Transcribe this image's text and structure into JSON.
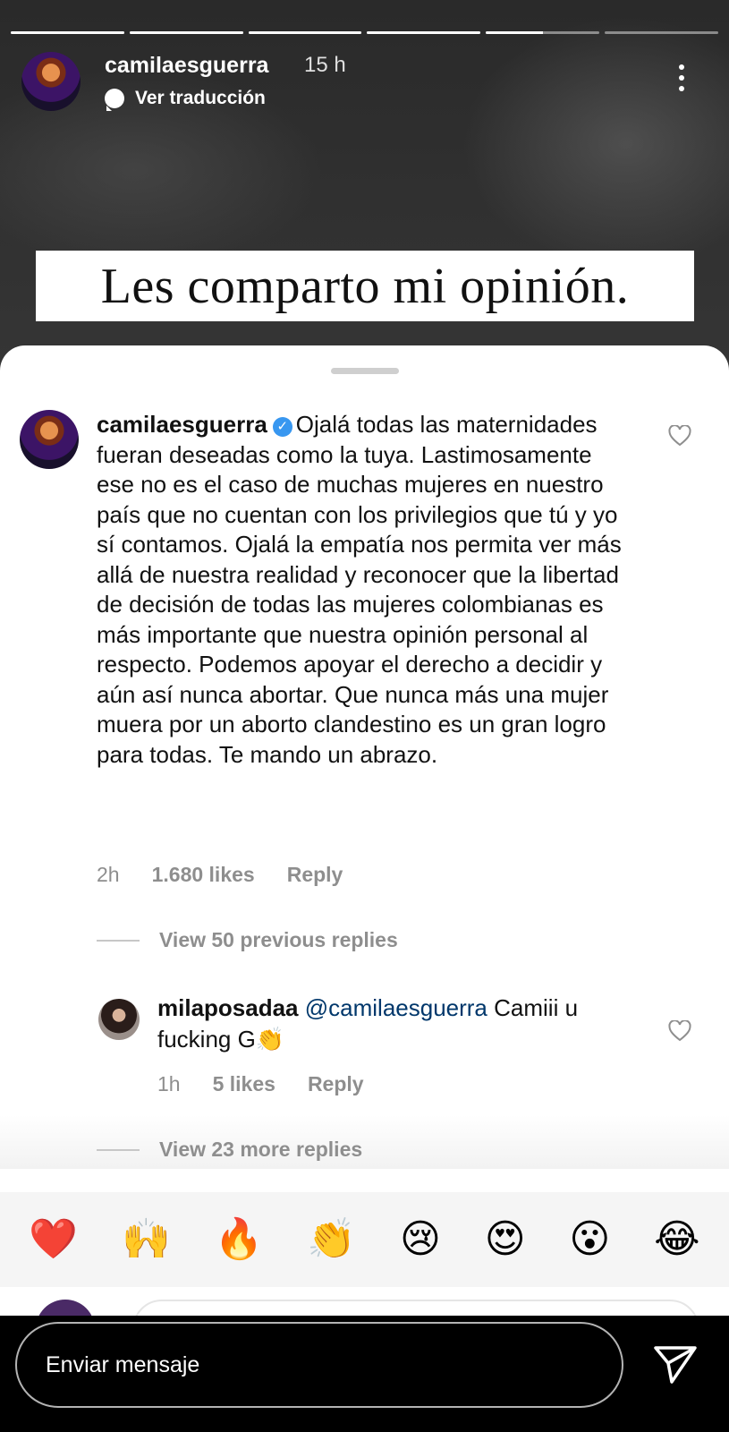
{
  "story": {
    "username": "camilaesguerra",
    "time": "15 h",
    "translate_label": "Ver traducción",
    "caption": "Les comparto mi opinión.",
    "progress": [
      1,
      1,
      1,
      1,
      0.5,
      0
    ]
  },
  "comment": {
    "username": "camilaesguerra",
    "verified": true,
    "text": "Ojalá todas las maternidades fueran  deseadas como la tuya. Lastimosamente ese no es el caso de muchas mujeres en nuestro país que no cuentan con los privilegios que tú y yo sí contamos. Ojalá la empatía nos permita ver más allá de nuestra realidad y reconocer que la libertad de decisión de todas las mujeres colombianas es más importante que nuestra opinión personal al respecto. Podemos apoyar el derecho a decidir y aún así nunca abortar. Que nunca más una mujer muera por un aborto clandestino es un gran logro para todas. Te mando un abrazo.",
    "time": "2h",
    "likes": "1.680 likes",
    "reply_label": "Reply"
  },
  "view_previous": "View 50 previous replies",
  "reply": {
    "username": "milaposadaa",
    "mention": "@camilaesguerra",
    "text": "Camiii u fucking G👏",
    "time": "1h",
    "likes": "5 likes",
    "reply_label": "Reply"
  },
  "view_more": "View 23 more replies",
  "quick_reactions": [
    "❤️",
    "🙌",
    "🔥",
    "👏",
    "😢",
    "😍",
    "😮",
    "😂"
  ],
  "message_placeholder": "Enviar mensaje",
  "icons": {
    "menu": "more-vertical-icon",
    "send": "send-icon",
    "like": "heart-outline-icon",
    "translate": "speech-bubble-icon",
    "verified": "verified-badge-icon"
  }
}
